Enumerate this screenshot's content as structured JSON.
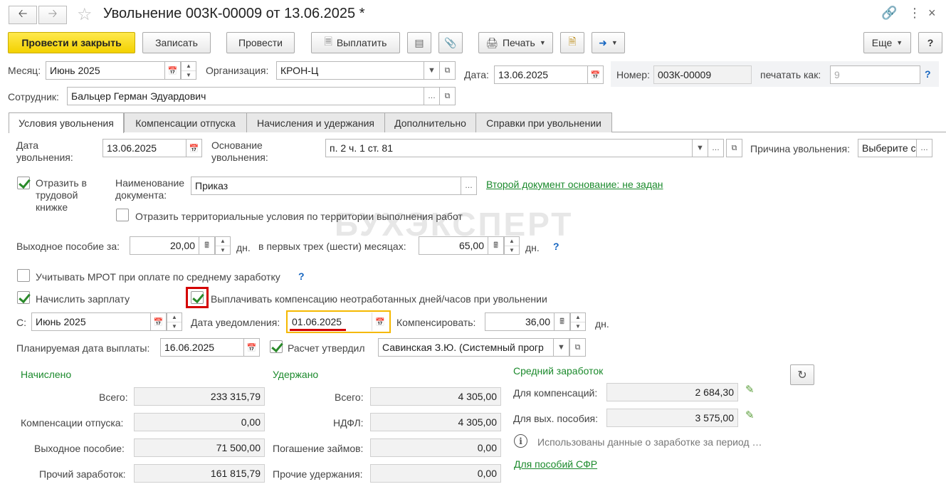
{
  "window": {
    "title": "Увольнение 003К-00009 от 13.06.2025 *"
  },
  "toolbar": {
    "post_close": "Провести и закрыть",
    "save": "Записать",
    "post": "Провести",
    "pay": "Выплатить",
    "print": "Печать",
    "more": "Еще",
    "help": "?"
  },
  "header": {
    "month_label": "Месяц:",
    "month_value": "Июнь 2025",
    "org_label": "Организация:",
    "org_value": "КРОН-Ц",
    "date_label": "Дата:",
    "date_value": "13.06.2025",
    "number_label": "Номер:",
    "number_value": "003К-00009",
    "print_as_label": "печатать как:",
    "print_as_value": "9",
    "employee_label": "Сотрудник:",
    "employee_value": "Бальцер Герман Эдуардович"
  },
  "tabs": [
    {
      "label": "Условия увольнения"
    },
    {
      "label": "Компенсации отпуска"
    },
    {
      "label": "Начисления и удержания"
    },
    {
      "label": "Дополнительно"
    },
    {
      "label": "Справки при увольнении"
    }
  ],
  "conditions": {
    "dismissal_date_label": "Дата увольнения:",
    "dismissal_date_value": "13.06.2025",
    "basis_label": "Основание увольнения:",
    "basis_value": "п. 2 ч. 1 ст. 81",
    "reason_label": "Причина увольнения:",
    "reason_value": "Выберите с",
    "workbook_label": "Отразить в трудовой книжке",
    "doc_name_label": "Наименование документа:",
    "doc_name_value": "Приказ",
    "second_doc_link": "Второй документ основание: не задан",
    "territorial_label": "Отразить территориальные условия по территории выполнения работ",
    "severance_label": "Выходное пособие за:",
    "severance_value": "20,00",
    "days_unit": "дн.",
    "first_months_label": "в первых трех (шести) месяцах:",
    "first_months_value": "65,00",
    "mrot_label": "Учитывать МРОТ при оплате по среднему заработку",
    "accrue_salary_label": "Начислить зарплату",
    "pay_comp_label": "Выплачивать компенсацию неотработанных дней/часов при увольнении",
    "from_label": "С:",
    "from_value": "Июнь 2025",
    "notice_date_label": "Дата уведомления:",
    "notice_date_value": "01.06.2025",
    "compensate_label": "Компенсировать:",
    "compensate_value": "36,00",
    "planned_pay_label": "Планируемая дата выплаты:",
    "planned_pay_value": "16.06.2025",
    "approved_label": "Расчет утвердил",
    "approved_value": "Савинская З.Ю. (Системный прогр"
  },
  "accrued": {
    "heading": "Начислено",
    "total_label": "Всего:",
    "total_value": "233 315,79",
    "vacation_label": "Компенсации отпуска:",
    "vacation_value": "0,00",
    "severance_label": "Выходное пособие:",
    "severance_value": "71 500,00",
    "other_label": "Прочий заработок:",
    "other_value": "161 815,79"
  },
  "withheld": {
    "heading": "Удержано",
    "total_label": "Всего:",
    "total_value": "4 305,00",
    "ndfl_label": "НДФЛ:",
    "ndfl_value": "4 305,00",
    "loans_label": "Погашение займов:",
    "loans_value": "0,00",
    "other_label": "Прочие удержания:",
    "other_value": "0,00"
  },
  "average": {
    "heading": "Средний заработок",
    "comp_label": "Для компенсаций:",
    "comp_value": "2 684,30",
    "severance_label": "Для вых. пособия:",
    "severance_value": "3 575,00",
    "info_text": "Использованы данные о заработке за период …",
    "sfr_link": "Для пособий СФР"
  },
  "watermark": "БУХЭКСПЕРТ"
}
